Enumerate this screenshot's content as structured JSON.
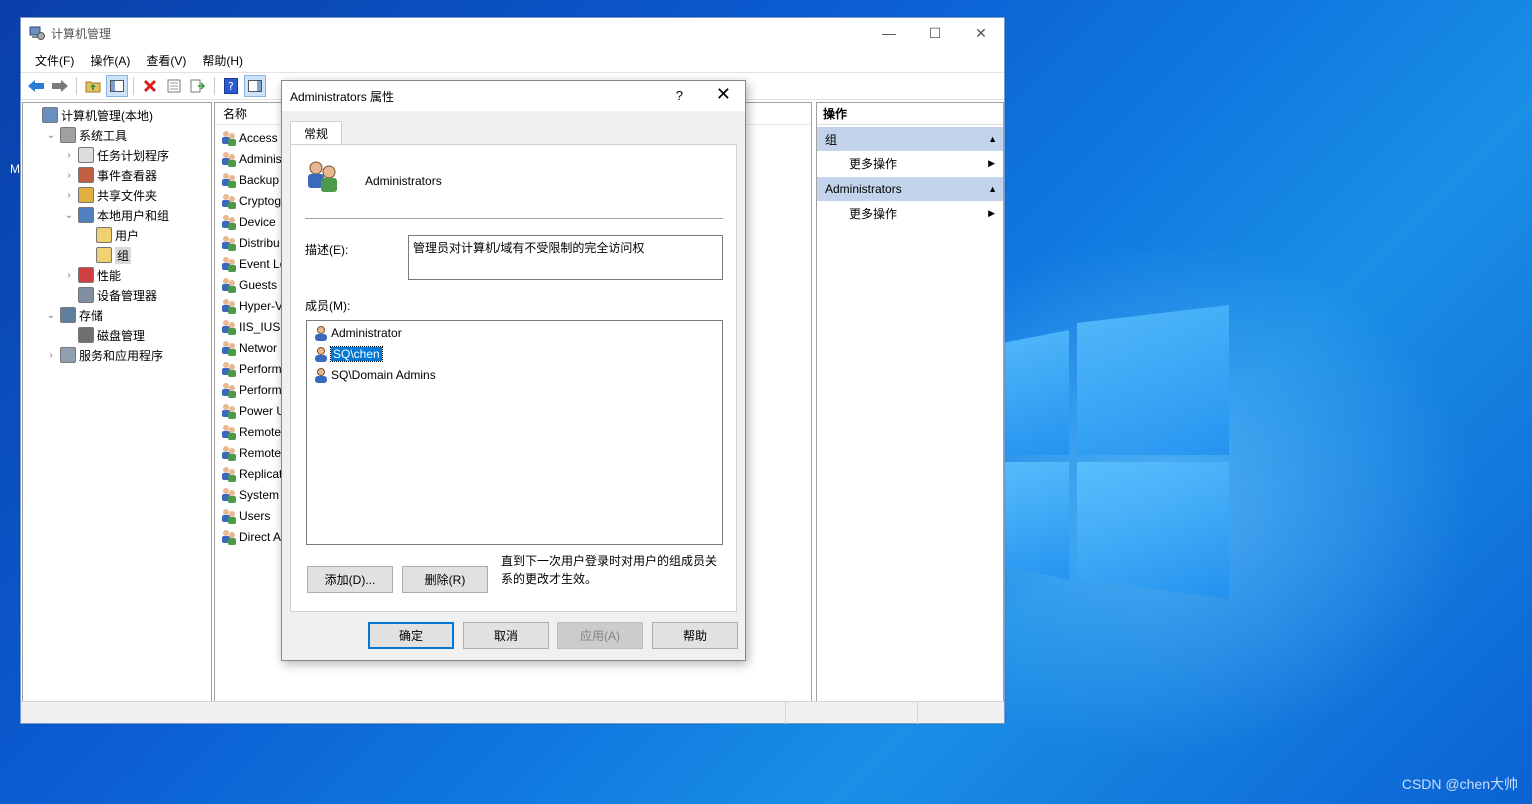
{
  "window": {
    "title": "计算机管理",
    "minimize": "—",
    "maximize": "☐",
    "close": "✕"
  },
  "menu": [
    "文件(F)",
    "操作(A)",
    "查看(V)",
    "帮助(H)"
  ],
  "tree": [
    {
      "label": "计算机管理(本地)",
      "level": 0,
      "exp": ""
    },
    {
      "label": "系统工具",
      "level": 1,
      "exp": "⌄"
    },
    {
      "label": "任务计划程序",
      "level": 2,
      "exp": "›"
    },
    {
      "label": "事件查看器",
      "level": 2,
      "exp": "›"
    },
    {
      "label": "共享文件夹",
      "level": 2,
      "exp": "›"
    },
    {
      "label": "本地用户和组",
      "level": 2,
      "exp": "⌄"
    },
    {
      "label": "用户",
      "level": 3,
      "exp": ""
    },
    {
      "label": "组",
      "level": 3,
      "exp": "",
      "selected": true
    },
    {
      "label": "性能",
      "level": 2,
      "exp": "›"
    },
    {
      "label": "设备管理器",
      "level": 2,
      "exp": ""
    },
    {
      "label": "存储",
      "level": 1,
      "exp": "⌄"
    },
    {
      "label": "磁盘管理",
      "level": 2,
      "exp": ""
    },
    {
      "label": "服务和应用程序",
      "level": 1,
      "exp": "›"
    }
  ],
  "list": {
    "header": "名称",
    "rows": [
      "Access",
      "Adminis",
      "Backup",
      "Cryptog",
      "Device",
      "Distribu",
      "Event Lo",
      "Guests",
      "Hyper-V",
      "IIS_IUSR",
      "Networ",
      "Perform",
      "Perform",
      "Power U",
      "Remote",
      "Remote",
      "Replicat",
      "System",
      "Users",
      "Direct A"
    ]
  },
  "actions": {
    "header": "操作",
    "groups": [
      {
        "label": "组",
        "item": "更多操作"
      },
      {
        "label": "Administrators",
        "item": "更多操作"
      }
    ]
  },
  "dialog": {
    "title": "Administrators 属性",
    "help": "?",
    "close": "✕",
    "tab": "常规",
    "group_name": "Administrators",
    "desc_label": "描述(E):",
    "desc_value": "管理员对计算机/域有不受限制的完全访问权",
    "members_label": "成员(M):",
    "members": [
      {
        "name": "Administrator",
        "selected": false
      },
      {
        "name": "SQ\\chen",
        "selected": true
      },
      {
        "name": "SQ\\Domain Admins",
        "selected": false
      }
    ],
    "add": "添加(D)...",
    "remove": "删除(R)",
    "note": "直到下一次用户登录时对用户的组成员关系的更改才生效。",
    "ok": "确定",
    "cancel": "取消",
    "apply": "应用(A)",
    "helpbtn": "帮助"
  },
  "desktop": {
    "watermark": "CSDN @chen大帅",
    "icon_label": "M"
  }
}
